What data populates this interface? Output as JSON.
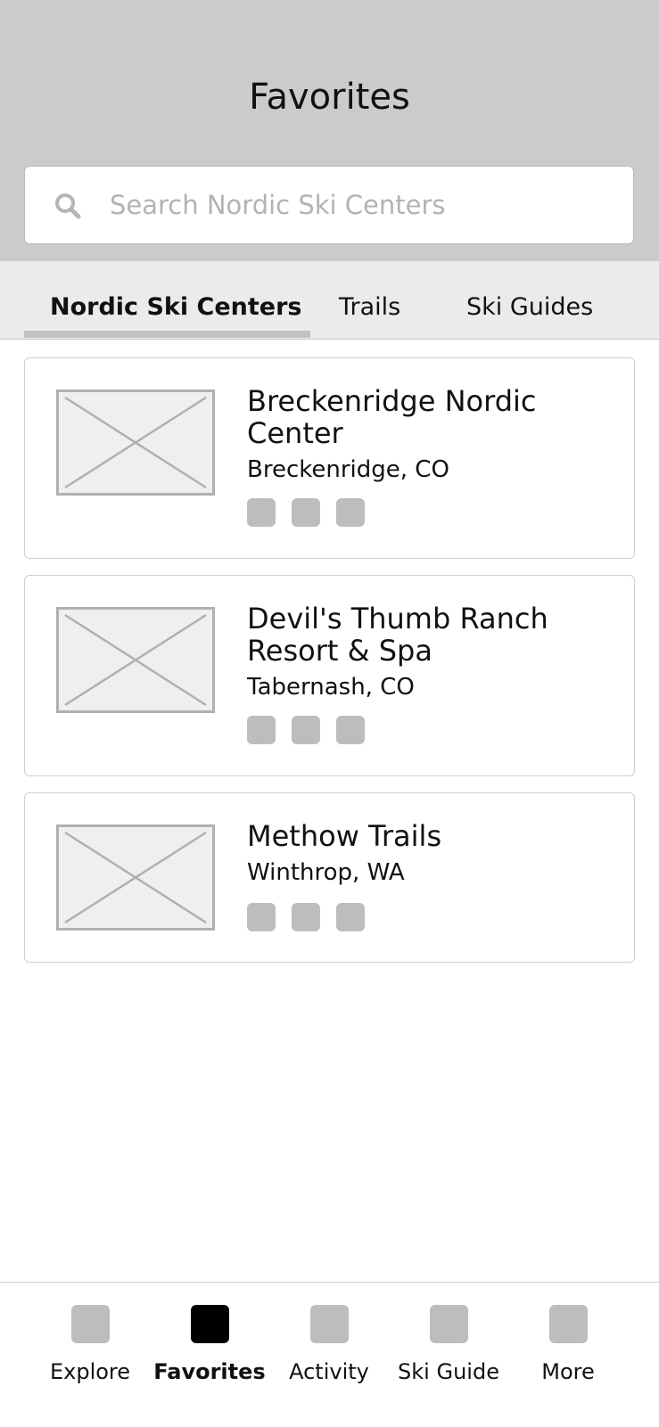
{
  "header": {
    "title": "Favorites"
  },
  "search": {
    "placeholder": "Search Nordic Ski Centers",
    "value": ""
  },
  "tabs": [
    {
      "label": "Nordic Ski Centers",
      "active": true
    },
    {
      "label": "Trails",
      "active": false
    },
    {
      "label": "Ski Guides",
      "active": false
    }
  ],
  "favorites": [
    {
      "name": "Breckenridge Nordic Center",
      "location": "Breckenridge, CO"
    },
    {
      "name": "Devil's Thumb Ranch Resort & Spa",
      "location": "Tabernash, CO"
    },
    {
      "name": "Methow Trails",
      "location": "Winthrop, WA"
    }
  ],
  "bottom_nav": [
    {
      "label": "Explore",
      "active": false
    },
    {
      "label": "Favorites",
      "active": true
    },
    {
      "label": "Activity",
      "active": false
    },
    {
      "label": "Ski Guide",
      "active": false
    },
    {
      "label": "More",
      "active": false
    }
  ],
  "colors": {
    "header_bg": "#cbcbcb",
    "tabs_bg": "#ebebeb",
    "placeholder_gray": "#bdbdbd",
    "active_icon": "#000000"
  }
}
